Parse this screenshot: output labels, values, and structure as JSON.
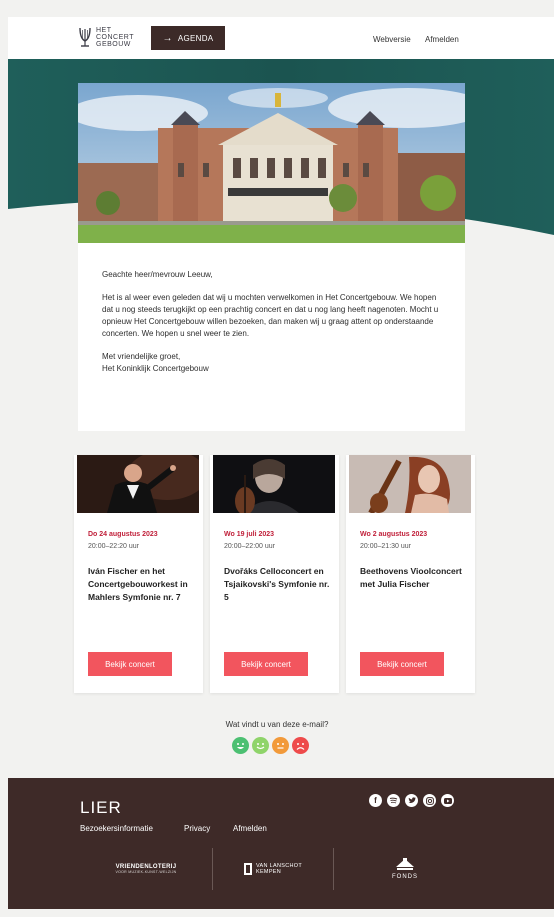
{
  "header": {
    "logo_lines": [
      "HET",
      "CONCERT",
      "GEBOUW"
    ],
    "agenda_label": "AGENDA",
    "webversie_label": "Webversie",
    "afmelden_label": "Afmelden"
  },
  "colors": {
    "teal": "#1f5f5a",
    "header_dark": "#3c2a28",
    "accent_red": "#c0203a",
    "button_coral": "#f2555e",
    "footer_bg": "#3e2a28"
  },
  "letter": {
    "greeting": "Geachte heer/mevrouw Leeuw,",
    "body": "Het is al weer even geleden dat wij u mochten verwelkomen in Het Concertgebouw. We hopen dat u nog steeds terugkijkt op een prachtig concert en dat u nog lang heeft nagenoten. Mocht u opnieuw Het Concertgebouw willen bezoeken, dan maken wij u graag attent op onderstaande concerten. We hopen u snel weer te zien.",
    "closing": "Met vriendelijke groet,",
    "signature": "Het Koninklijk Concertgebouw"
  },
  "concerts": [
    {
      "date": "Do 24 augustus 2023",
      "time": "20:00–22:20 uur",
      "title": "Iván Fischer en het Concertgebouworkest in Mahlers Symfonie nr. 7",
      "button": "Bekijk concert"
    },
    {
      "date": "Wo 19 juli 2023",
      "time": "20:00–22:00 uur",
      "title": "Dvořáks Celloconcert en Tsjaikovski's Symfonie nr. 5",
      "button": "Bekijk concert"
    },
    {
      "date": "Wo 2 augustus 2023",
      "time": "20:00–21:30 uur",
      "title": "Beethovens Vioolconcert met Julia Fischer",
      "button": "Bekijk concert"
    }
  ],
  "feedback": {
    "question": "Wat vindt u van deze e-mail?",
    "smileys": [
      {
        "icon": "very-happy-face-icon",
        "color": "#4cc072"
      },
      {
        "icon": "happy-face-icon",
        "color": "#8fd46a"
      },
      {
        "icon": "neutral-face-icon",
        "color": "#f29a3a"
      },
      {
        "icon": "sad-face-icon",
        "color": "#ee4b4b"
      }
    ]
  },
  "footer": {
    "brand": "LIER",
    "links": [
      "Bezoekersinformatie",
      "Privacy",
      "Afmelden"
    ],
    "socials": [
      "facebook-icon",
      "spotify-icon",
      "twitter-icon",
      "instagram-icon",
      "youtube-icon"
    ],
    "sponsors": [
      {
        "name": "VRIENDENLOTERIJ",
        "sub": "VOOR MUZIEK-KUNST-WELZIJN"
      },
      {
        "name": "VAN LANSCHOT KEMPEN",
        "sub": ""
      },
      {
        "name": "FONDS",
        "sub": ""
      }
    ]
  }
}
